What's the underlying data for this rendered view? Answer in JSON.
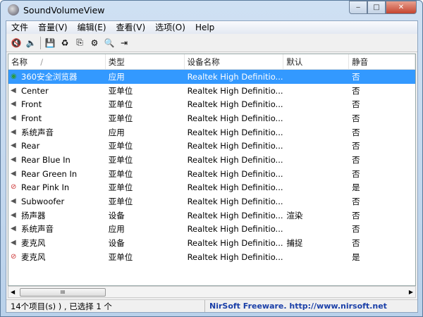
{
  "window": {
    "title": "SoundVolumeView",
    "minimize": "‒",
    "maximize": "□",
    "close": "✕"
  },
  "menu": [
    "文件",
    "音量(V)",
    "编辑(E)",
    "查看(V)",
    "选项(O)",
    "Help"
  ],
  "toolbar": [
    {
      "icon": "mute-icon",
      "glyph": "🔇"
    },
    {
      "icon": "unmute-icon",
      "glyph": "🔈"
    },
    {
      "icon": "save-icon",
      "glyph": "💾"
    },
    {
      "icon": "refresh-icon",
      "glyph": "♻"
    },
    {
      "icon": "copy-icon",
      "glyph": "⎘"
    },
    {
      "icon": "properties-icon",
      "glyph": "⚙"
    },
    {
      "icon": "find-icon",
      "glyph": "🔍"
    },
    {
      "icon": "exit-icon",
      "glyph": "⇥"
    }
  ],
  "columns": [
    "名称",
    "类型",
    "设备名称",
    "默认",
    "静音"
  ],
  "sort_indicator": "/",
  "rows": [
    {
      "name": "360安全浏览器",
      "type": "应用",
      "device": "Realtek High Definitio...",
      "default": "",
      "mute": "否",
      "selected": true,
      "muted_icon": false
    },
    {
      "name": "Center",
      "type": "亚单位",
      "device": "Realtek High Definitio...",
      "default": "",
      "mute": "否",
      "muted_icon": false
    },
    {
      "name": "Front",
      "type": "亚单位",
      "device": "Realtek High Definitio...",
      "default": "",
      "mute": "否",
      "muted_icon": false
    },
    {
      "name": "Front",
      "type": "亚单位",
      "device": "Realtek High Definitio...",
      "default": "",
      "mute": "否",
      "muted_icon": false
    },
    {
      "name": "系统声音",
      "type": "应用",
      "device": "Realtek High Definitio...",
      "default": "",
      "mute": "否",
      "muted_icon": false
    },
    {
      "name": "Rear",
      "type": "亚单位",
      "device": "Realtek High Definitio...",
      "default": "",
      "mute": "否",
      "muted_icon": false
    },
    {
      "name": "Rear Blue In",
      "type": "亚单位",
      "device": "Realtek High Definitio...",
      "default": "",
      "mute": "否",
      "muted_icon": false
    },
    {
      "name": "Rear Green In",
      "type": "亚单位",
      "device": "Realtek High Definitio...",
      "default": "",
      "mute": "否",
      "muted_icon": false
    },
    {
      "name": "Rear Pink In",
      "type": "亚单位",
      "device": "Realtek High Definitio...",
      "default": "",
      "mute": "是",
      "muted_icon": true
    },
    {
      "name": "Subwoofer",
      "type": "亚单位",
      "device": "Realtek High Definitio...",
      "default": "",
      "mute": "否",
      "muted_icon": false
    },
    {
      "name": "扬声器",
      "type": "设备",
      "device": "Realtek High Definitio...",
      "default": "渲染",
      "mute": "否",
      "muted_icon": false
    },
    {
      "name": "系统声音",
      "type": "应用",
      "device": "Realtek High Definitio...",
      "default": "",
      "mute": "否",
      "muted_icon": false
    },
    {
      "name": "麦克风",
      "type": "设备",
      "device": "Realtek High Definitio...",
      "default": "捕捉",
      "mute": "否",
      "muted_icon": false
    },
    {
      "name": "麦克风",
      "type": "亚单位",
      "device": "Realtek High Definitio...",
      "default": "",
      "mute": "是",
      "muted_icon": true
    }
  ],
  "scrollbar": {
    "thumb": "III",
    "left": "◀",
    "right": "▶"
  },
  "status": {
    "items": "14个项目(s) ) , 已选择 1 个",
    "link": "NirSoft Freeware.  http://www.nirsoft.net"
  }
}
